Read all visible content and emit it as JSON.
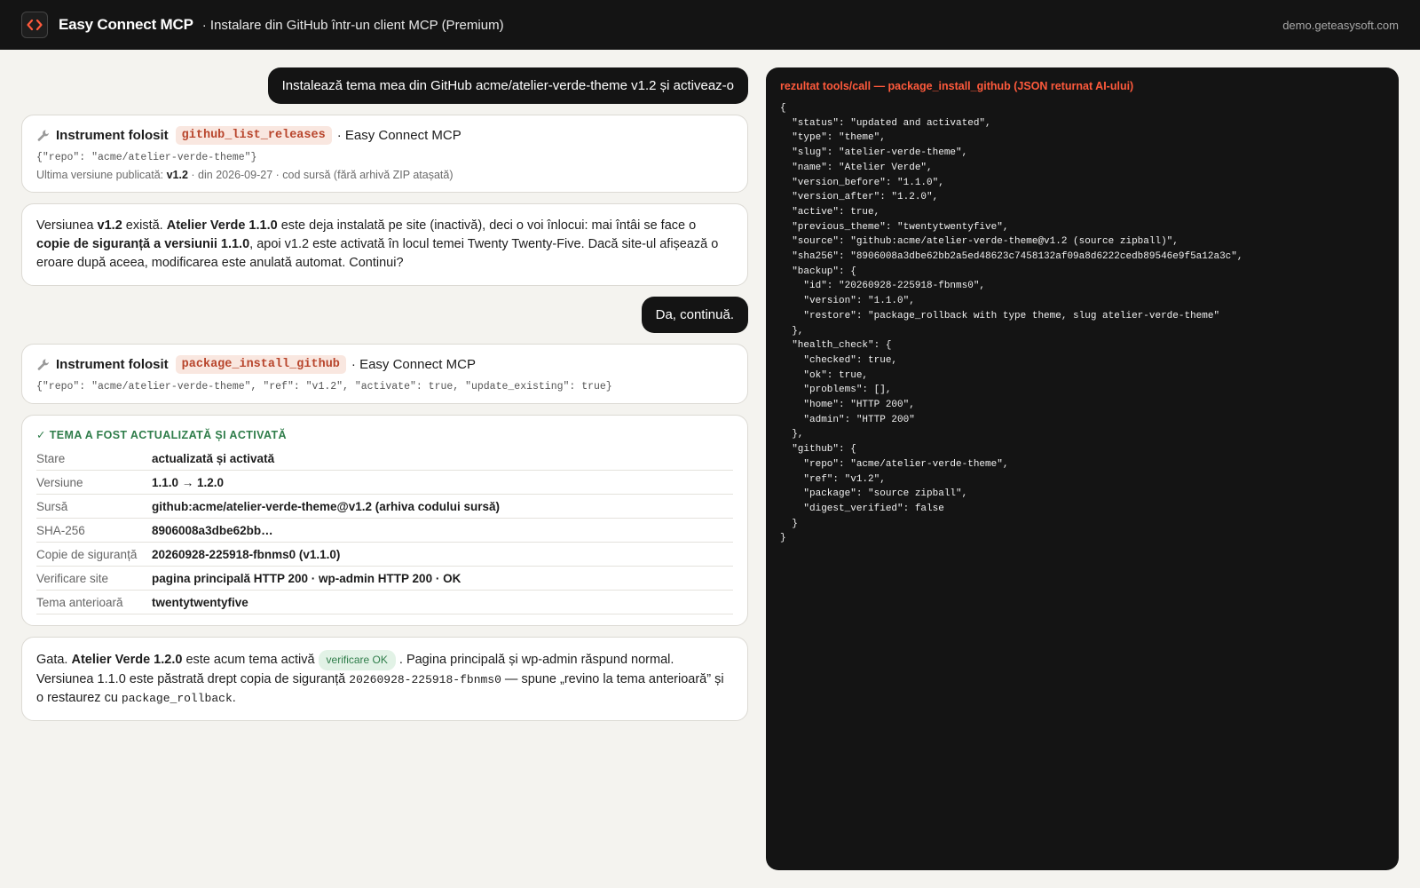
{
  "header": {
    "brand": "Easy Connect MCP",
    "subtitle": "· Instalare din GitHub într-un client MCP (Premium)",
    "domain": "demo.geteasysoft.com"
  },
  "chat": {
    "user_msg_1": "Instalează tema mea din GitHub acme/atelier-verde-theme v1.2 și activeaz-o",
    "tool_1": {
      "label": "Instrument folosit",
      "name": "github_list_releases",
      "via": "· Easy Connect MCP",
      "args": "{\"repo\": \"acme/atelier-verde-theme\"}",
      "meta_prefix": "Ultima versiune publicată: ",
      "meta_version": "v1.2",
      "meta_suffix": " · din 2026-09-27 · cod sursă (fără arhivă ZIP atașată)"
    },
    "assistant_1": {
      "t1": "Versiunea ",
      "b1": "v1.2",
      "t2": " există. ",
      "b2": "Atelier Verde 1.1.0",
      "t3": " este deja instalată pe site (inactivă), deci o voi înlocui: mai întâi se face o ",
      "b3": "copie de siguranță a versiunii 1.1.0",
      "t4": ", apoi v1.2 este activată în locul temei Twenty Twenty-Five. Dacă site-ul afișează o eroare după aceea, modificarea este anulată automat. Continui?"
    },
    "user_msg_2": "Da, continuă.",
    "tool_2": {
      "label": "Instrument folosit",
      "name": "package_install_github",
      "via": "· Easy Connect MCP",
      "args": "{\"repo\": \"acme/atelier-verde-theme\", \"ref\": \"v1.2\", \"activate\": true, \"update_existing\": true}"
    },
    "result": {
      "title": "✓ TEMA A FOST ACTUALIZATĂ ȘI ACTIVATĂ",
      "rows": [
        {
          "key": "Stare",
          "value": "actualizată și activată"
        },
        {
          "key": "Versiune",
          "value": "1.1.0 → 1.2.0"
        },
        {
          "key": "Sursă",
          "value": "github:acme/atelier-verde-theme@v1.2 (arhiva codului sursă)"
        },
        {
          "key": "SHA-256",
          "value": "8906008a3dbe62bb…"
        },
        {
          "key": "Copie de siguranță",
          "value": "20260928-225918-fbnms0 (v1.1.0)"
        },
        {
          "key": "Verificare site",
          "value": "pagina principală HTTP 200 · wp-admin HTTP 200 · OK"
        },
        {
          "key": "Tema anterioară",
          "value": "twentytwentyfive"
        }
      ]
    },
    "assistant_2": {
      "t1": "Gata. ",
      "b1": "Atelier Verde 1.2.0",
      "t2": " este acum tema activă",
      "pill": "verificare OK",
      "t3": ". Pagina principală și wp-admin răspund normal. Versiunea 1.1.0 este păstrată drept copia de siguranță ",
      "code1": "20260928-225918-fbnms0",
      "t4": " — spune „revino la tema anterioară” și o restaurez cu ",
      "code2": "package_rollback",
      "t5": "."
    }
  },
  "panel": {
    "title": "rezultat tools/call — package_install_github (JSON returnat AI-ului)",
    "json": "{\n  \"status\": \"updated and activated\",\n  \"type\": \"theme\",\n  \"slug\": \"atelier-verde-theme\",\n  \"name\": \"Atelier Verde\",\n  \"version_before\": \"1.1.0\",\n  \"version_after\": \"1.2.0\",\n  \"active\": true,\n  \"previous_theme\": \"twentytwentyfive\",\n  \"source\": \"github:acme/atelier-verde-theme@v1.2 (source zipball)\",\n  \"sha256\": \"8906008a3dbe62bb2a5ed48623c7458132af09a8d6222cedb89546e9f5a12a3c\",\n  \"backup\": {\n    \"id\": \"20260928-225918-fbnms0\",\n    \"version\": \"1.1.0\",\n    \"restore\": \"package_rollback with type theme, slug atelier-verde-theme\"\n  },\n  \"health_check\": {\n    \"checked\": true,\n    \"ok\": true,\n    \"problems\": [],\n    \"home\": \"HTTP 200\",\n    \"admin\": \"HTTP 200\"\n  },\n  \"github\": {\n    \"repo\": \"acme/atelier-verde-theme\",\n    \"ref\": \"v1.2\",\n    \"package\": \"source zipball\",\n    \"digest_verified\": false\n  }\n}"
  },
  "colors": {
    "accent": "#ff5a3c",
    "success": "#2f7d4a",
    "dark": "#141414"
  },
  "icons": [
    "code-brackets-icon",
    "wrench-icon"
  ]
}
